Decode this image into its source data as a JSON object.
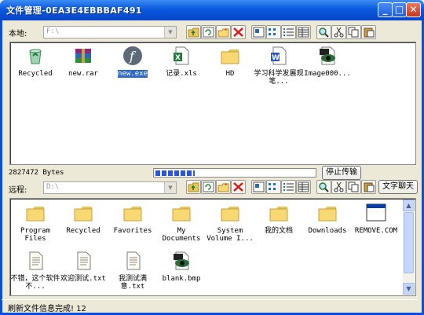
{
  "window": {
    "title": "文件管理-0EA3E4EBBBAF491"
  },
  "local": {
    "label": "本地:",
    "path": "F:\\",
    "items": [
      {
        "name": "Recycled",
        "icon": "recycle-bin-icon"
      },
      {
        "name": "new.rar",
        "icon": "rar-archive-icon"
      },
      {
        "name": "new.exe",
        "icon": "flash-exe-icon",
        "selected": true
      },
      {
        "name": "记录.xls",
        "icon": "excel-file-icon"
      },
      {
        "name": "HD",
        "icon": "folder-icon"
      },
      {
        "name": "学习科学发展观笔...",
        "icon": "word-file-icon"
      },
      {
        "name": "Image000...",
        "icon": "image-file-icon"
      }
    ]
  },
  "transfer": {
    "bytes": "2827472 Bytes",
    "progress": 0.25,
    "stop_label": "停止传输"
  },
  "remote": {
    "label": "远程:",
    "path": "D:\\",
    "chat_label": "文字聊天",
    "items": [
      {
        "name": "Program Files",
        "icon": "folder-icon"
      },
      {
        "name": "Recycled",
        "icon": "folder-icon"
      },
      {
        "name": "Favorites",
        "icon": "folder-icon"
      },
      {
        "name": "My Documents",
        "icon": "folder-icon"
      },
      {
        "name": "System Volume I...",
        "icon": "folder-icon"
      },
      {
        "name": "我的文档",
        "icon": "folder-icon"
      },
      {
        "name": "Downloads",
        "icon": "folder-icon"
      },
      {
        "name": "REMOVE.COM",
        "icon": "window-icon"
      },
      {
        "name": "不错，这个软件不...",
        "icon": "text-file-icon"
      },
      {
        "name": "欢迎测试.txt",
        "icon": "text-file-icon"
      },
      {
        "name": "我测试满意.txt",
        "icon": "text-file-icon"
      },
      {
        "name": "blank.bmp",
        "icon": "image-file-icon"
      }
    ]
  },
  "toolbar_icons": [
    "up-folder-icon",
    "refresh-icon",
    "new-folder-icon",
    "delete-icon",
    "large-icons-view-icon",
    "small-icons-view-icon",
    "list-view-icon",
    "details-view-icon",
    "search-icon",
    "cut-icon",
    "copy-icon",
    "paste-icon"
  ],
  "status": {
    "text": "刷新文件信息完成! 12"
  }
}
